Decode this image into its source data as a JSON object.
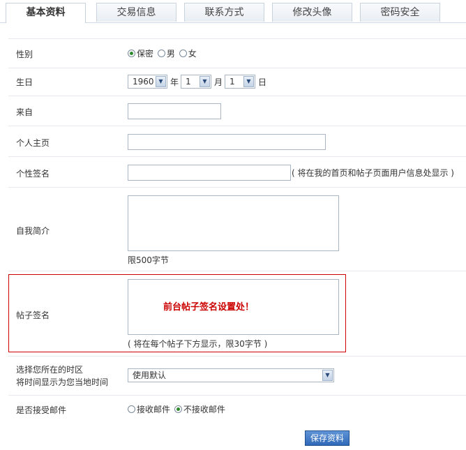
{
  "tabs": [
    {
      "label": "基本资料",
      "active": true
    },
    {
      "label": "交易信息",
      "active": false
    },
    {
      "label": "联系方式",
      "active": false
    },
    {
      "label": "修改头像",
      "active": false
    },
    {
      "label": "密码安全",
      "active": false
    }
  ],
  "gender": {
    "label": "性别",
    "options": [
      "保密",
      "男",
      "女"
    ],
    "selected": "保密"
  },
  "birthday": {
    "label": "生日",
    "year": "1960",
    "year_unit": "年",
    "month": "1",
    "month_unit": "月",
    "day": "1",
    "day_unit": "日"
  },
  "from": {
    "label": "来自",
    "value": ""
  },
  "homepage": {
    "label": "个人主页",
    "value": ""
  },
  "signature": {
    "label": "个性签名",
    "value": "",
    "hint": "( 将在我的首页和帖子页面用户信息处显示 )"
  },
  "bio": {
    "label": "自我简介",
    "value": "",
    "limit": "限500字节"
  },
  "post_signature": {
    "label": "帖子签名",
    "overlay_text": "前台帖子签名设置处！",
    "hint": "( 将在每个帖子下方显示，限30字节 )"
  },
  "timezone": {
    "label_line1": "选择您所在的时区",
    "label_line2": "将时间显示为您当地时间",
    "value": "使用默认"
  },
  "email": {
    "label": "是否接受邮件",
    "options": [
      "接收邮件",
      "不接收邮件"
    ],
    "selected": "不接收邮件"
  },
  "save_label": "保存资料",
  "colors": {
    "accent": "#2f69b8",
    "highlight": "#cc0000",
    "check": "#2f8a2f"
  }
}
